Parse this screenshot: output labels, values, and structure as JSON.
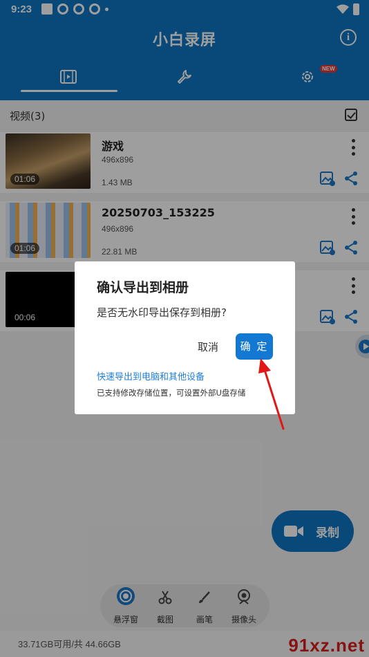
{
  "status_bar": {
    "time": "9:23"
  },
  "header": {
    "title": "小白录屏"
  },
  "tabs": {
    "badge": "NEW"
  },
  "videos": {
    "section_label": "视频(3)",
    "items": [
      {
        "name": "游戏",
        "resolution": "496x896",
        "size": "1.43 MB",
        "duration": "01:06"
      },
      {
        "name": "20250703_153225",
        "resolution": "496x896",
        "size": "22.81 MB",
        "duration": "01:06"
      },
      {
        "name": "",
        "resolution": "",
        "size": "",
        "duration": "00:06"
      }
    ]
  },
  "tools": [
    {
      "label": "悬浮窗"
    },
    {
      "label": "截图"
    },
    {
      "label": "画笔"
    },
    {
      "label": "摄像头"
    }
  ],
  "record_button": {
    "label": "录制"
  },
  "footer": {
    "storage": "33.71GB可用/共 44.66GB",
    "watermark": "91xz.net"
  },
  "dialog": {
    "title": "确认导出到相册",
    "message": "是否无水印导出保存到相册?",
    "cancel": "取消",
    "confirm": "确 定",
    "link": "快速导出到电脑和其他设备",
    "note": "已支持修改存储位置，可设置外部U盘存储"
  },
  "colors": {
    "primary": "#0d76c4",
    "confirm": "#1278d2",
    "link": "#1f7ed8",
    "annotation_arrow": "#e01818"
  }
}
